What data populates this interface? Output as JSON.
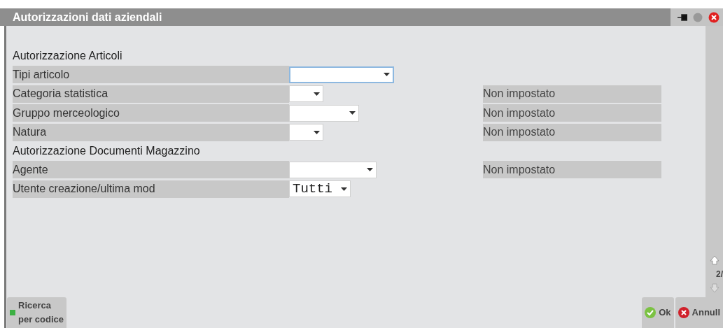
{
  "window": {
    "title": "Autorizzazioni dati aziendali"
  },
  "sections": [
    {
      "title": "Autorizzazione Articoli",
      "rows": [
        {
          "label": "Tipi articolo",
          "focused": true
        },
        {
          "label": "Categoria statistica",
          "focused": false,
          "readout": "Non impostato"
        },
        {
          "label": "Gruppo merceologico",
          "focused": false,
          "readout": "Non impostato"
        },
        {
          "label": "Natura",
          "focused": false,
          "readout": "Non impostato"
        }
      ]
    },
    {
      "title": "Autorizzazione Documenti Magazzino",
      "rows": [
        {
          "label": "Agente",
          "focused": false,
          "readout": "Non impostato"
        },
        {
          "label": "Utente creazione/ultima mod",
          "value": "Tutti",
          "focused": false
        }
      ]
    }
  ],
  "pager": "2/",
  "footer": {
    "left_button": "Ricerca\nper codice",
    "ok_button": "Ok",
    "cancel_button": "Annull"
  }
}
